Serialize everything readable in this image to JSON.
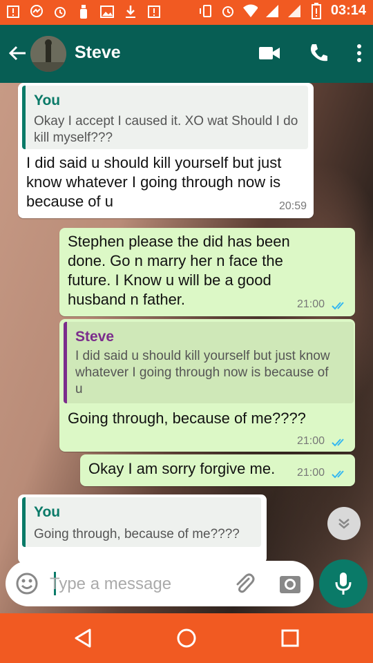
{
  "status_bar": {
    "time": "03:14",
    "icons": [
      "alert-icon",
      "messenger-icon",
      "alarm-icon",
      "bottle-icon",
      "image-icon",
      "download-icon",
      "alert-icon",
      "vibrate-icon",
      "alarm-icon",
      "wifi-icon",
      "signal-icon",
      "signal-icon",
      "battery-low-icon"
    ]
  },
  "header": {
    "contact_name": "Steve",
    "icons": [
      "back-arrow-icon",
      "video-call-icon",
      "phone-icon",
      "more-vert-icon"
    ]
  },
  "messages": [
    {
      "direction": "incoming",
      "quote": {
        "sender": "You",
        "text": "Okay I accept I caused it. XO wat Should I do kill myself???"
      },
      "text": "I did said u should kill yourself but just know whatever I going through now is because of u",
      "time": "20:59"
    },
    {
      "direction": "outgoing",
      "text": "Stephen please the did has been done. Go n marry her n face the future. I Know u will be a good husband n father.",
      "time": "21:00",
      "status": "read"
    },
    {
      "direction": "outgoing",
      "quote": {
        "sender": "Steve",
        "text": "I did said u should kill yourself but just know whatever I going through now is because of u"
      },
      "text": "Going through, because of me????",
      "time": "21:00",
      "status": "read"
    },
    {
      "direction": "outgoing",
      "text": "Okay I am sorry forgive me.",
      "time": "21:00",
      "status": "read"
    },
    {
      "direction": "incoming",
      "quote": {
        "sender": "You",
        "text": "Going through, because of me????"
      },
      "text": "",
      "time": ""
    }
  ],
  "input": {
    "placeholder": "Type a message"
  },
  "colors": {
    "status_bar": "#f15a22",
    "app_bar": "#075e54",
    "outgoing_bubble": "#dcf8c6",
    "accent": "#0a7a68",
    "read_ticks": "#34b7f1"
  }
}
